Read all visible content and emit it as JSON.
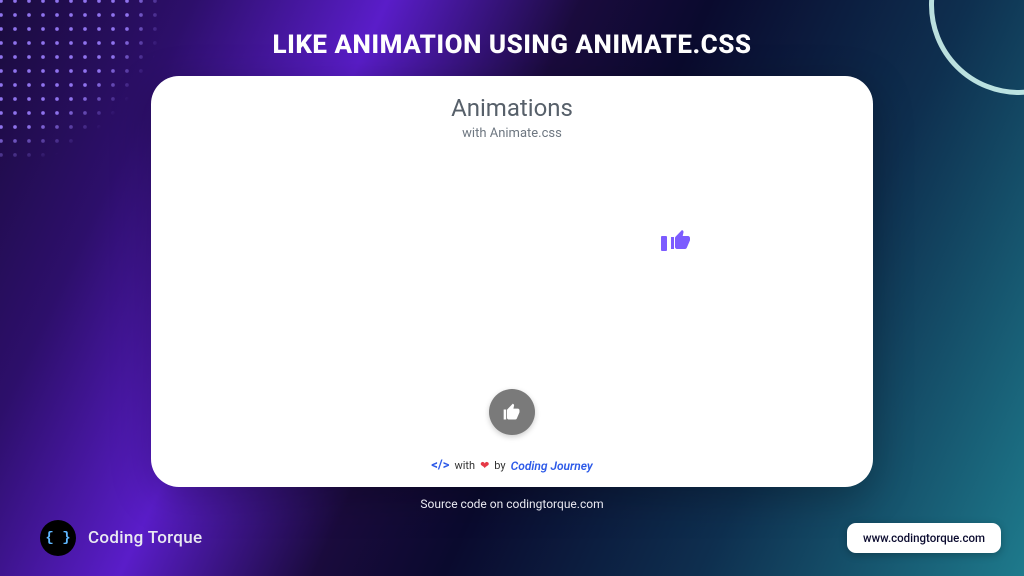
{
  "page": {
    "title": "LIKE ANIMATION USING ANIMATE.CSS",
    "source_line": "Source code on codingtorque.com"
  },
  "card": {
    "title": "Animations",
    "subtitle": "with Animate.css",
    "footer": {
      "with": "with",
      "by": "by",
      "author": "Coding Journey"
    }
  },
  "brand": {
    "name": "Coding Torque",
    "logo_text": "{ }"
  },
  "url_pill": "www.codingtorque.com",
  "colors": {
    "accent_thumb": "#7c5cff",
    "like_btn_bg": "#7a7a7a"
  }
}
